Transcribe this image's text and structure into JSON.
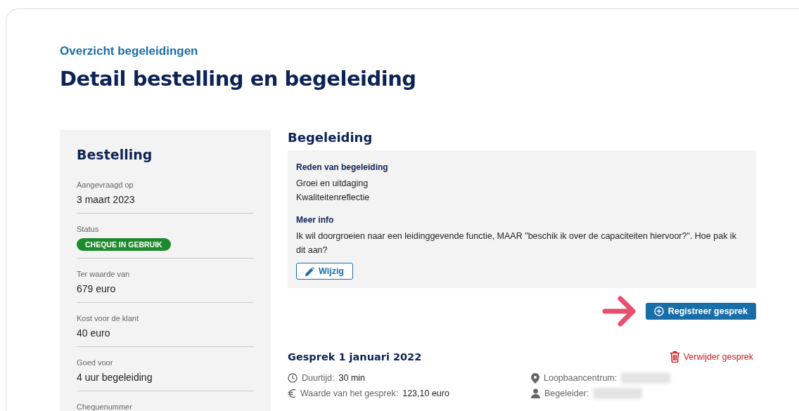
{
  "breadcrumb": "Overzicht begeleidingen",
  "title": "Detail bestelling en begeleiding",
  "order": {
    "heading": "Bestelling",
    "fields": [
      {
        "kind": "text",
        "label": "Aangevraagd op",
        "value": "3 maart 2023"
      },
      {
        "kind": "badge",
        "label": "Status",
        "value": "CHEQUE IN GEBRUIK"
      },
      {
        "kind": "text",
        "label": "Ter waarde van",
        "value": "679 euro"
      },
      {
        "kind": "text",
        "label": "Kost voor de klant",
        "value": "40 euro"
      },
      {
        "kind": "text",
        "label": "Goed voor",
        "value": "4 uur begeleiding"
      },
      {
        "kind": "label",
        "label": "Chequenummer"
      }
    ]
  },
  "guidance": {
    "heading": "Begeleiding",
    "reason_label": "Reden van begeleiding",
    "reasons": [
      "Groei en uitdaging",
      "Kwaliteitenreflectie"
    ],
    "info_label": "Meer info",
    "info": "Ik wil doorgroeien naar een leidinggevende functie, MAAR \"beschik ik over de capaciteiten hiervoor?\". Hoe pak ik dit aan?",
    "edit_button": "Wijzig",
    "register_button": "Registreer gesprek"
  },
  "conversation": {
    "title": "Gesprek 1 januari 2022",
    "delete_link": "Verwijder gesprek",
    "details": [
      {
        "kind": "clock",
        "label": "Duurtijd:",
        "value": "30 min",
        "redacted": false
      },
      {
        "kind": "pin",
        "label": "Loopbaancentrum:",
        "redacted": true
      },
      {
        "kind": "euro",
        "label": "Waarde van het gesprek:",
        "value": "123,10 euro",
        "redacted": false
      },
      {
        "kind": "person",
        "label": "Begeleider:",
        "redacted": true
      }
    ]
  }
}
